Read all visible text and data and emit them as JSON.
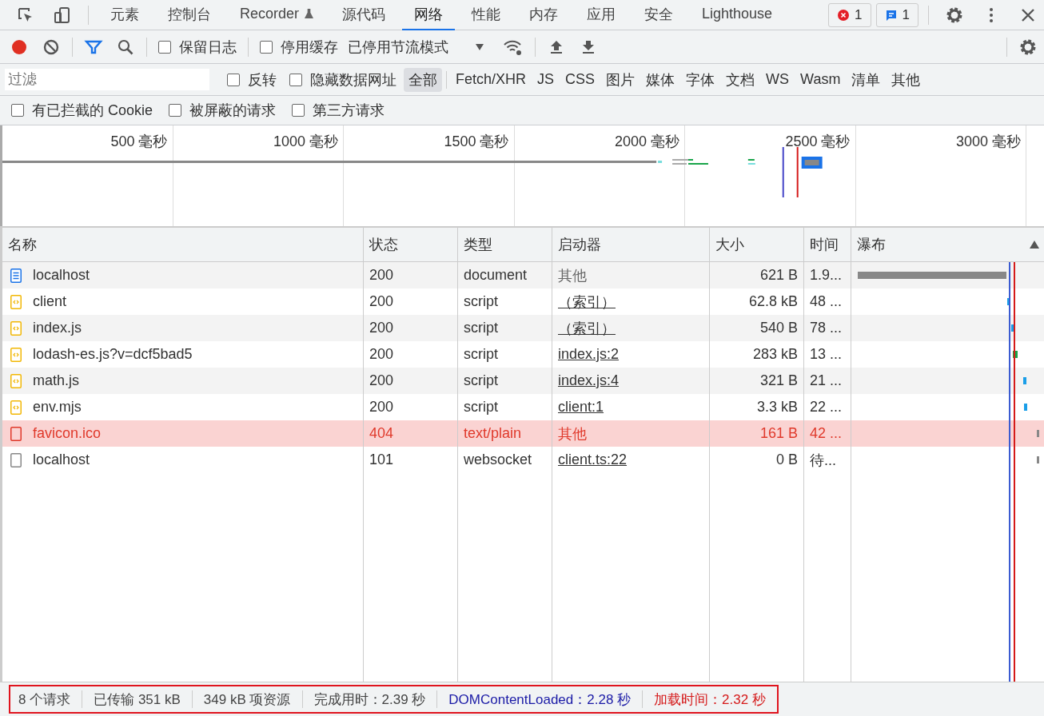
{
  "tabs": [
    {
      "label": "元素",
      "selected": false,
      "experimental": false
    },
    {
      "label": "控制台",
      "selected": false,
      "experimental": false
    },
    {
      "label": "Recorder",
      "selected": false,
      "experimental": true
    },
    {
      "label": "源代码",
      "selected": false,
      "experimental": false
    },
    {
      "label": "网络",
      "selected": true,
      "experimental": false
    },
    {
      "label": "性能",
      "selected": false,
      "experimental": false
    },
    {
      "label": "内存",
      "selected": false,
      "experimental": false
    },
    {
      "label": "应用",
      "selected": false,
      "experimental": false
    },
    {
      "label": "安全",
      "selected": false,
      "experimental": false
    },
    {
      "label": "Lighthouse",
      "selected": false,
      "experimental": false
    }
  ],
  "badges": {
    "errors": "1",
    "messages": "1"
  },
  "toolbar": {
    "recording": true,
    "preserve_log": {
      "label": "保留日志",
      "checked": false
    },
    "disable_cache": {
      "label": "停用缓存",
      "checked": false
    },
    "throttling": "已停用节流模式"
  },
  "filter": {
    "placeholder": "过滤",
    "invert": {
      "label": "反转",
      "checked": false
    },
    "hide_data_urls": {
      "label": "隐藏数据网址",
      "checked": false
    },
    "types": [
      {
        "label": "全部",
        "selected": true
      },
      {
        "label": "Fetch/XHR",
        "selected": false
      },
      {
        "label": "JS",
        "selected": false
      },
      {
        "label": "CSS",
        "selected": false
      },
      {
        "label": "图片",
        "selected": false
      },
      {
        "label": "媒体",
        "selected": false
      },
      {
        "label": "字体",
        "selected": false
      },
      {
        "label": "文档",
        "selected": false
      },
      {
        "label": "WS",
        "selected": false
      },
      {
        "label": "Wasm",
        "selected": false
      },
      {
        "label": "清单",
        "selected": false
      },
      {
        "label": "其他",
        "selected": false
      }
    ],
    "extra": [
      {
        "label": "有已拦截的 Cookie",
        "checked": false
      },
      {
        "label": "被屏蔽的请求",
        "checked": false
      },
      {
        "label": "第三方请求",
        "checked": false
      }
    ]
  },
  "overview": {
    "ticks": [
      "500 毫秒",
      "1000 毫秒",
      "1500 毫秒",
      "2000 毫秒",
      "2500 毫秒",
      "3000 毫秒"
    ]
  },
  "table": {
    "columns": [
      "名称",
      "状态",
      "类型",
      "启动器",
      "大小",
      "时间",
      "瀑布"
    ],
    "rows": [
      {
        "kind": "document",
        "name": "localhost",
        "status": "200",
        "type": "document",
        "initiator": "其他",
        "initiator_link": false,
        "size": "621 B",
        "time": "1.9...",
        "failed": false
      },
      {
        "kind": "script",
        "name": "client",
        "status": "200",
        "type": "script",
        "initiator": "（索引）",
        "initiator_link": true,
        "size": "62.8 kB",
        "time": "48 ...",
        "failed": false
      },
      {
        "kind": "script",
        "name": "index.js",
        "status": "200",
        "type": "script",
        "initiator": "（索引）",
        "initiator_link": true,
        "size": "540 B",
        "time": "78 ...",
        "failed": false
      },
      {
        "kind": "script",
        "name": "lodash-es.js?v=dcf5bad5",
        "status": "200",
        "type": "script",
        "initiator": "index.js:2",
        "initiator_link": true,
        "size": "283 kB",
        "time": "13 ...",
        "failed": false
      },
      {
        "kind": "script",
        "name": "math.js",
        "status": "200",
        "type": "script",
        "initiator": "index.js:4",
        "initiator_link": true,
        "size": "321 B",
        "time": "21 ...",
        "failed": false
      },
      {
        "kind": "script",
        "name": "env.mjs",
        "status": "200",
        "type": "script",
        "initiator": "client:1",
        "initiator_link": true,
        "size": "3.3 kB",
        "time": "22 ...",
        "failed": false
      },
      {
        "kind": "other",
        "name": "favicon.ico",
        "status": "404",
        "type": "text/plain",
        "initiator": "其他",
        "initiator_link": false,
        "size": "161 B",
        "time": "42 ...",
        "failed": true
      },
      {
        "kind": "other",
        "name": "localhost",
        "status": "101",
        "type": "websocket",
        "initiator": "client.ts:22",
        "initiator_link": true,
        "size": "0 B",
        "time": "待...",
        "failed": false
      }
    ]
  },
  "status_bar": [
    {
      "kind": "plain",
      "text": "8 个请求"
    },
    {
      "kind": "plain",
      "text": "已传输 351 kB"
    },
    {
      "kind": "plain",
      "text": "349 kB 项资源"
    },
    {
      "kind": "plain",
      "text": "完成用时：2.39 秒"
    },
    {
      "kind": "dom",
      "text": "DOMContentLoaded：2.28 秒"
    },
    {
      "kind": "load",
      "text": "加载时间：2.32 秒"
    }
  ]
}
